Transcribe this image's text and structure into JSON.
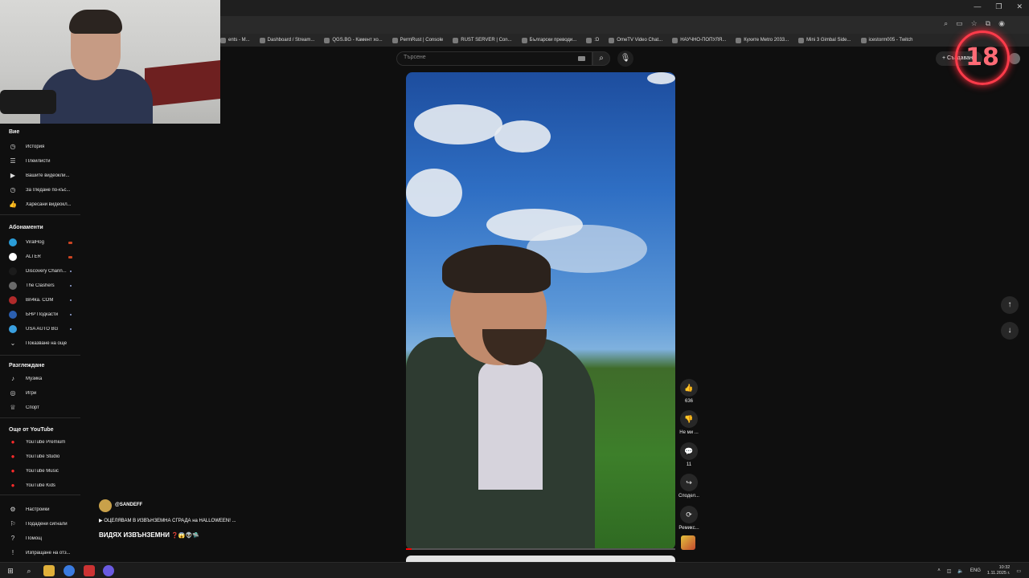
{
  "browser": {
    "bookmarks": [
      {
        "label": "ents - M..."
      },
      {
        "label": "Dashboard / Stream..."
      },
      {
        "label": "QGS.BG - Камент хо..."
      },
      {
        "label": "PermRust | Console"
      },
      {
        "label": "RUST SERVER | Con..."
      },
      {
        "label": "Български преводи..."
      },
      {
        "label": ":D"
      },
      {
        "label": "OmeTV Video Chat..."
      },
      {
        "label": "НАУЧНО-ПОПУЛЯ..."
      },
      {
        "label": "Кухите Metro 2033..."
      },
      {
        "label": "Mini 3 Gimbal Side..."
      },
      {
        "label": "icestorm005 - Twitch"
      }
    ]
  },
  "header": {
    "search_placeholder": "Търсене",
    "create_label": "Създаване",
    "badge_text": "18"
  },
  "sidebar": {
    "you_title": "Вие",
    "you_items": [
      {
        "icon": "history-icon",
        "glyph": "◷",
        "label": "История"
      },
      {
        "icon": "playlist-icon",
        "glyph": "☰",
        "label": "Плейлисти"
      },
      {
        "icon": "your-videos-icon",
        "glyph": "▶",
        "label": "Вашите видеокли..."
      },
      {
        "icon": "watch-later-icon",
        "glyph": "◷",
        "label": "За гледане по-къс..."
      },
      {
        "icon": "liked-icon",
        "glyph": "👍",
        "label": "Харесани видеокл..."
      }
    ],
    "subs_title": "Абонаменти",
    "subs": [
      {
        "label": "ViralHog",
        "color": "#2a9dd8",
        "live": true
      },
      {
        "label": "ALTER",
        "color": "#ffffff",
        "live": true
      },
      {
        "label": "Discovery Chann...",
        "color": "#1b1b1b",
        "live": false
      },
      {
        "label": "The Clashers",
        "color": "#6a6a6a",
        "live": false
      },
      {
        "label": "Bri4ka. COM",
        "color": "#b02a2a",
        "live": false
      },
      {
        "label": "БНР Подкасти",
        "color": "#2b5fb0",
        "live": false
      },
      {
        "label": "USA AUTO BG",
        "color": "#3aa0e0",
        "live": false
      }
    ],
    "show_more": "Показване на още",
    "explore_title": "Разглеждане",
    "explore_items": [
      {
        "icon": "music-icon",
        "glyph": "♪",
        "label": "Музика"
      },
      {
        "icon": "gaming-icon",
        "glyph": "◎",
        "label": "Игри"
      },
      {
        "icon": "sports-icon",
        "glyph": "♕",
        "label": "Спорт"
      }
    ],
    "more_title": "Още от YouTube",
    "more_items": [
      {
        "label": "YouTube Premium"
      },
      {
        "label": "YouTube Studio"
      },
      {
        "label": "YouTube Music"
      },
      {
        "label": "YouTube Kids"
      }
    ],
    "bottom_items": [
      {
        "icon": "settings-icon",
        "glyph": "⚙",
        "label": "Настройки"
      },
      {
        "icon": "report-flag-icon",
        "glyph": "⚐",
        "label": "Подадени сигнали"
      },
      {
        "icon": "help-icon",
        "glyph": "?",
        "label": "Помощ"
      },
      {
        "icon": "feedback-icon",
        "glyph": "!",
        "label": "Изпращане на отз..."
      }
    ]
  },
  "short": {
    "channel": "@SANDEFF",
    "title": "▶ ОЦЕЛЯВАМ В ИЗВЪНЗЕМНА СГРАДА на HALLOWEEN! ...",
    "subtitle": "ВИДЯХ ИЗВЪНЗЕМНИ",
    "subtitle_emoji": "❓😱👽🛸",
    "progress": 0.02,
    "actions": [
      {
        "icon": "like-icon",
        "glyph": "👍",
        "label": "636"
      },
      {
        "icon": "dislike-icon",
        "glyph": "👎",
        "label": "Не ми ..."
      },
      {
        "icon": "comment-icon",
        "glyph": "💬",
        "label": "11"
      },
      {
        "icon": "share-icon",
        "glyph": "↪",
        "label": "Сподел..."
      },
      {
        "icon": "remix-icon",
        "glyph": "⟳",
        "label": "Ремикс..."
      }
    ]
  },
  "taskbar": {
    "lang": "ENG",
    "time": "10:32",
    "date": "1.11.2025 г."
  }
}
